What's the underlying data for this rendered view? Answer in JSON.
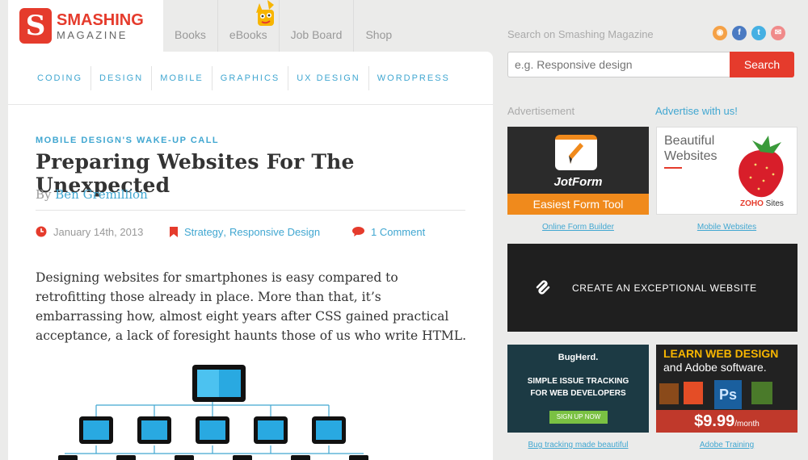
{
  "logo": {
    "line1": "SMASHING",
    "line2": "MAGAZINE",
    "mark": "S"
  },
  "top_nav": [
    "Books",
    "eBooks",
    "Job Board",
    "Shop"
  ],
  "categories": [
    "CODING",
    "DESIGN",
    "MOBILE",
    "GRAPHICS",
    "UX DESIGN",
    "WORDPRESS"
  ],
  "article": {
    "kicker": "MOBILE DESIGN'S WAKE-UP CALL",
    "title": "Preparing Websites For The Unexpected",
    "by": "By",
    "author": "Ben Gremillion",
    "date": "January 14th, 2013",
    "tag1": "Strategy",
    "tag_sep": ",",
    "tag2": "Responsive Design",
    "comments": "1 Comment",
    "intro": "Designing websites for smartphones is easy compared to retrofitting those already in place. More than that, it’s embarrassing how, almost eight years after CSS gained practical acceptance, a lack of foresight haunts those of us who write HTML."
  },
  "search": {
    "label": "Search on Smashing Magazine",
    "placeholder": "e.g. Responsive design",
    "button": "Search"
  },
  "social_icons": [
    "rss-icon",
    "facebook-icon",
    "twitter-icon",
    "email-icon"
  ],
  "ads": {
    "label": "Advertisement",
    "advertise_link": "Advertise with us!",
    "jotform": {
      "brand": "JotForm",
      "tagline": "Easiest Form Tool",
      "caption": "Online Form Builder"
    },
    "zoho": {
      "line1": "Beautiful",
      "line2": "Websites",
      "brand": "ZOHO",
      "brand2": "Sites",
      "caption": "Mobile Websites"
    },
    "squarespace": {
      "text": "CREATE AN EXCEPTIONAL WEBSITE"
    },
    "bugherd": {
      "brand": "BugHerd.",
      "line1": "SIMPLE ISSUE TRACKING",
      "line2": "FOR WEB DEVELOPERS",
      "button": "SIGN UP NOW",
      "caption": "Bug tracking made beautiful"
    },
    "adobe": {
      "line1": "LEARN WEB DESIGN",
      "line2": "and Adobe software.",
      "price": "$9.99",
      "per": "/month",
      "caption": "Adobe Training"
    }
  },
  "colors": {
    "brand_red": "#e53b2c",
    "link_blue": "#41a7d1"
  }
}
